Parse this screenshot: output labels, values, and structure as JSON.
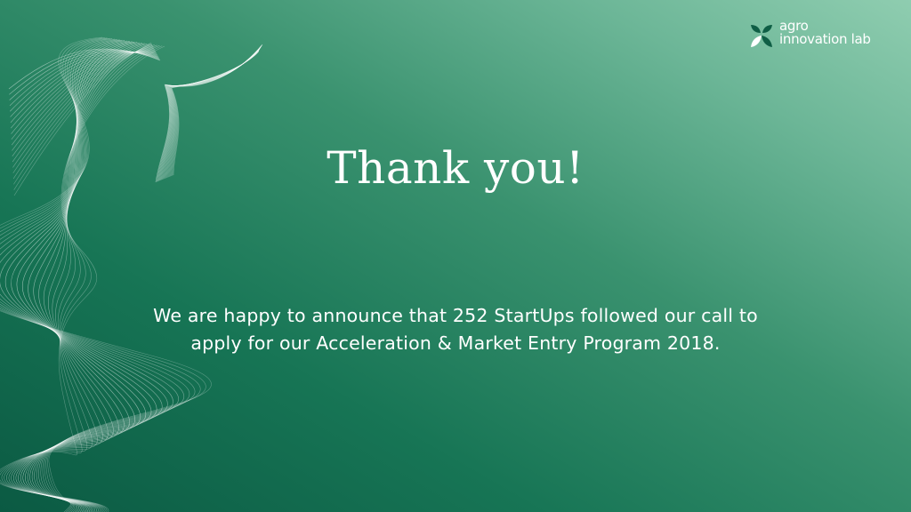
{
  "logo": {
    "line1": "agro",
    "line2": "innovation lab",
    "icon": "leaf-logo-icon"
  },
  "slide": {
    "title": "Thank you!",
    "message_line1": "We are happy to announce that 252 StartUps followed our call to",
    "message_line2": "apply for our Acceleration & Market Entry Program 2018."
  },
  "colors": {
    "background_dark": "#0b5a43",
    "background_light": "#8fcdb0",
    "text": "#ffffff",
    "logo_accent": "#0f5e45"
  },
  "decoration": "white-wave-lines"
}
